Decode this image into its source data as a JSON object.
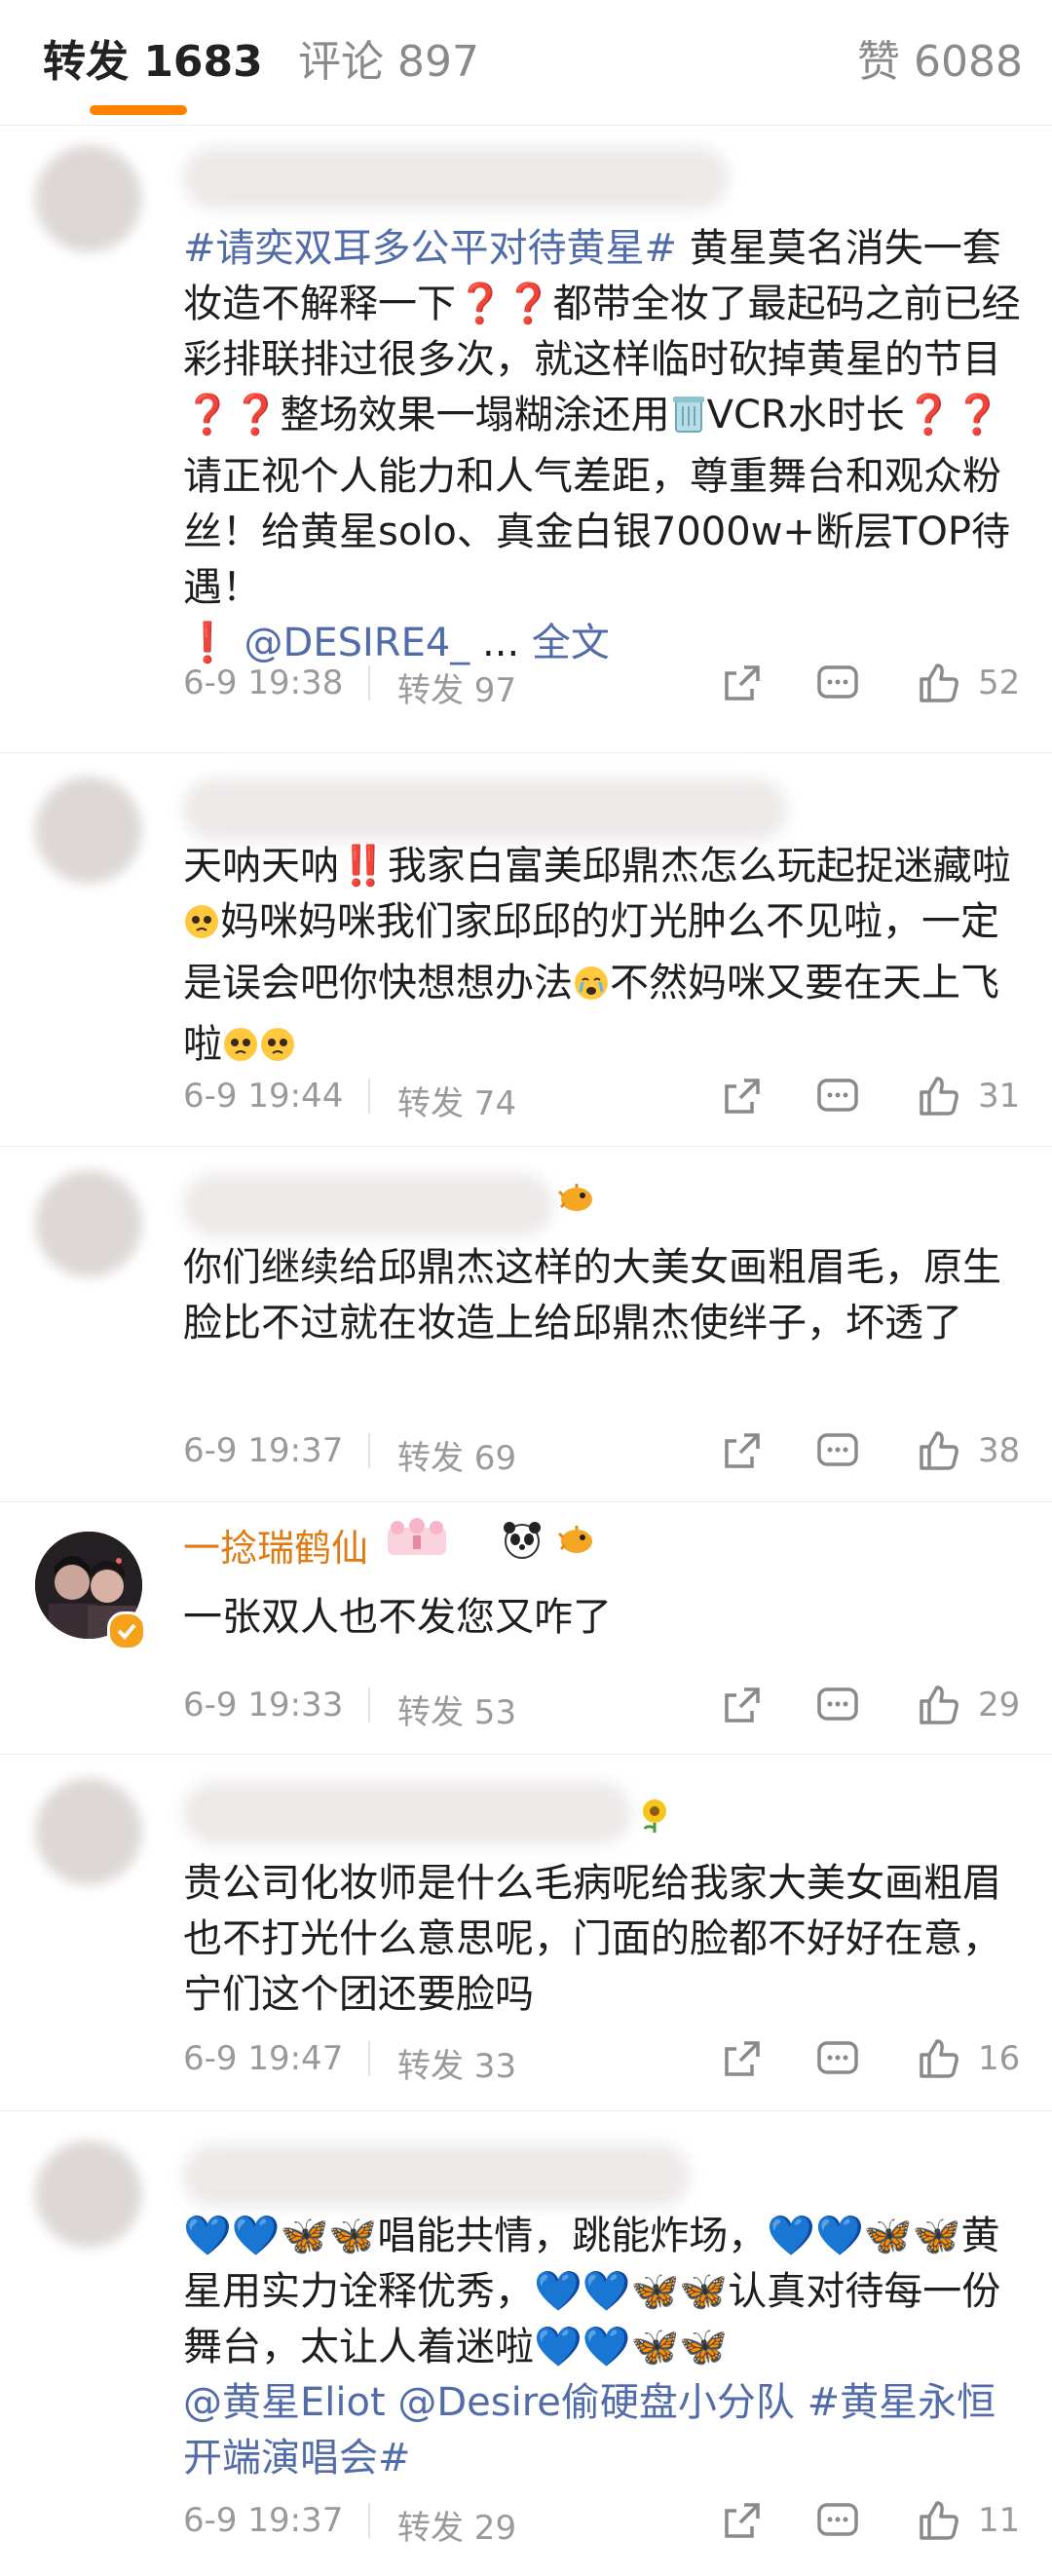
{
  "tabs": {
    "repost": "转发 1683",
    "comment": "评论 897",
    "like": "赞 6088"
  },
  "comments": [
    {
      "text_pre_link": "#请奕双耳多公平对待黄星#",
      "text_main": " 黄星莫名消失一套妆造不解释一下",
      "text_2": "都带全妆了最起码之前已经彩排联排过很多次，就这样临时砍掉黄星的节目",
      "text_3": "整场效果一塌糊涂还用",
      "text_4": "VCR水时长",
      "text_5": "请正视个人能力和人气差距，尊重舞台和观众粉丝！给黄星solo、真金白银7000w+断层TOP待遇！",
      "mention": "@DESIRE4_",
      "ellipsis": " ... ",
      "full_text": "全文",
      "time": "6-9 19:38",
      "repost": "转发 97",
      "likes": "52"
    },
    {
      "text_1": "天呐天呐",
      "text_2": "我家白富美邱鼎杰怎么玩起捉迷藏啦",
      "text_3": "妈咪妈咪我们家邱邱的灯光肿么不见啦，一定是误会吧你快想想办法",
      "text_4": "不然妈咪又要在天上飞啦",
      "time": "6-9 19:44",
      "repost": "转发 74",
      "likes": "31"
    },
    {
      "text": "你们继续给邱鼎杰这样的大美女画粗眉毛，原生脸比不过就在妆造上给邱鼎杰使绊子，坏透了",
      "time": "6-9 19:37",
      "repost": "转发 69",
      "likes": "38"
    },
    {
      "username": "一捻瑞鹤仙",
      "text": "一张双人也不发您又咋了",
      "time": "6-9 19:33",
      "repost": "转发 53",
      "likes": "29"
    },
    {
      "text": "贵公司化妆师是什么毛病呢给我家大美女画粗眉也不打光什么意思呢，门面的脸都不好好在意，宁们这个团还要脸吗",
      "time": "6-9 19:47",
      "repost": "转发 33",
      "likes": "16"
    },
    {
      "text_1": "唱能共情，跳能炸场，",
      "text_2": "黄星用实力诠释优秀，",
      "text_3": "认真对待每一份舞台，太让人着迷啦",
      "link_1": "@黄星Eliot",
      "link_2": "@Desire偷硬盘小分队",
      "link_3": "#黄星永恒开端演唱会#",
      "time": "6-9 19:37",
      "repost": "转发 29",
      "likes": "11"
    }
  ],
  "colors": {
    "accent": "#ff8200",
    "link": "#516ca8",
    "meta": "#9a9a9a",
    "username": "#e07a12"
  }
}
